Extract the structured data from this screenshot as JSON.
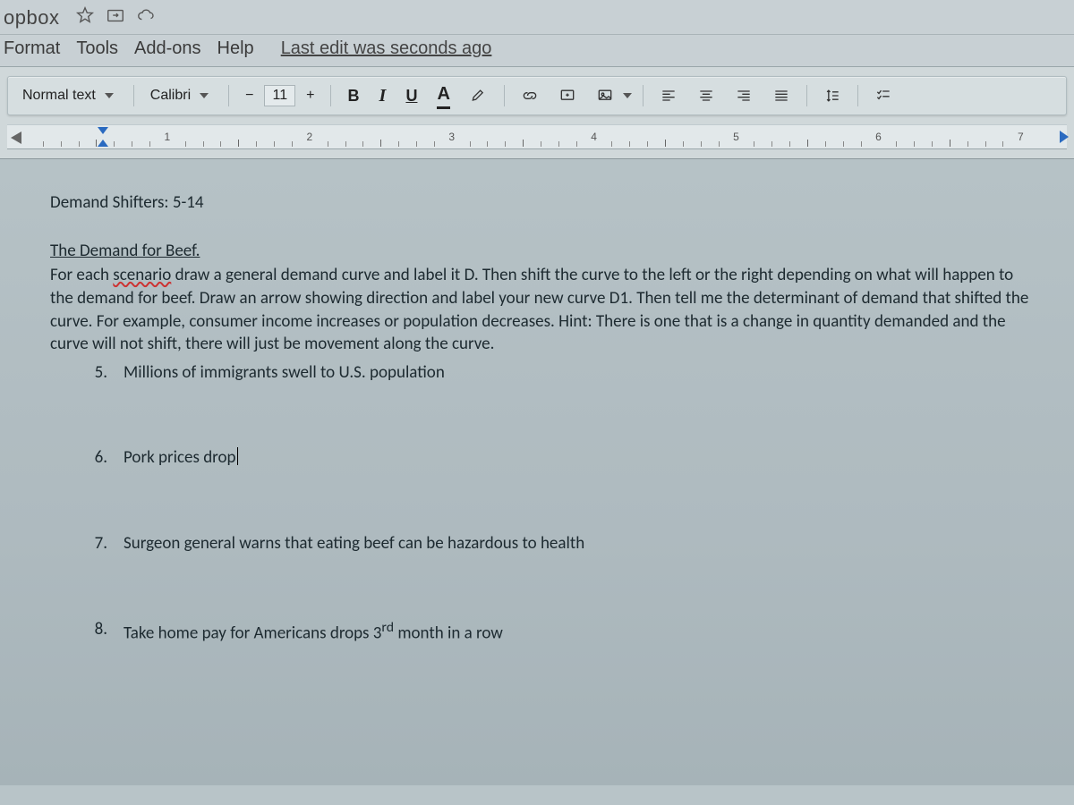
{
  "title": "opbox",
  "menubar": {
    "format": "Format",
    "tools": "Tools",
    "addons": "Add-ons",
    "help": "Help",
    "last_edit": "Last edit was seconds ago"
  },
  "toolbar": {
    "style_select": "Normal text",
    "font_select": "Calibri",
    "font_size": "11",
    "bold": "B",
    "italic": "I",
    "underline": "U",
    "text_color": "A"
  },
  "ruler": {
    "numbers": [
      "1",
      "2",
      "3",
      "4",
      "5",
      "6",
      "7"
    ]
  },
  "document": {
    "heading": "Demand Shifters: 5-14",
    "subheading": "The Demand for Beef.",
    "instructions_pre": "For each ",
    "instructions_wavy1": "scenario",
    "instructions_mid1": " draw a general demand curve and label it D. Then shift the curve to the left or the right depending on what will happen to the demand for beef. Draw an arrow showing direction and label your new curve D1. Then tell me the determinant of demand that shifted the curve. For example, consumer income increases or population decreases. Hint: There is one that is a change in quantity demanded and the curve will not shift, there will just be movement along the curve.",
    "items": [
      {
        "n": "5.",
        "text": "Millions of immigrants swell to U.S. population"
      },
      {
        "n": "6.",
        "text": "Pork prices drop"
      },
      {
        "n": "7.",
        "text": "Surgeon general warns that eating beef can be hazardous to health"
      },
      {
        "n": "8.",
        "text_pre": "Take home pay for Americans drops 3",
        "sup": "rd",
        "text_post": " month in a row"
      }
    ]
  }
}
